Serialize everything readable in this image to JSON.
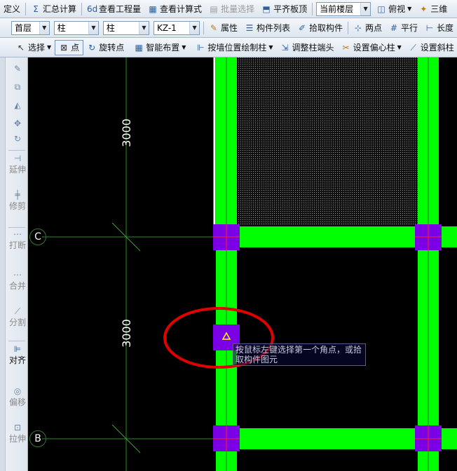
{
  "toolbar1": {
    "define": "定义",
    "sum_calc": "汇总计算",
    "view_quantity": "查看工程量",
    "view_formula": "查看计算式",
    "batch_select": "批量选择",
    "align_slab_top": "平齐板顶",
    "current_floor": "当前楼层",
    "top_view": "俯视",
    "three_d": "三维"
  },
  "toolbar2": {
    "floor_value": "首层",
    "type_value": "柱",
    "subtype_value": "柱",
    "component_value": "KZ-1",
    "properties": "属性",
    "component_list": "构件列表",
    "pick_component": "拾取构件",
    "two_points": "两点",
    "parallel": "平行",
    "long": "长度"
  },
  "toolbar3": {
    "select": "选择",
    "point": "点",
    "rotate_point": "旋转点",
    "smart_layout": "智能布置",
    "draw_by_wall": "按墙位置绘制柱",
    "adjust_column_end": "调整柱端头",
    "set_eccentric": "设置偏心柱",
    "set_slant": "设置斜柱"
  },
  "sidebar": {
    "items": [
      {
        "label": "延伸",
        "icon": "extend-icon"
      },
      {
        "label": "修剪",
        "icon": "trim-icon"
      },
      {
        "label": "打断",
        "icon": "break-icon"
      },
      {
        "label": "合并",
        "icon": "merge-icon"
      },
      {
        "label": "分割",
        "icon": "split-icon"
      },
      {
        "label": "对齐",
        "icon": "align-icon"
      },
      {
        "label": "偏移",
        "icon": "offset-icon"
      },
      {
        "label": "拉伸",
        "icon": "stretch-icon"
      }
    ]
  },
  "canvas": {
    "dim_top": "3000",
    "dim_mid": "3000",
    "axis_c": "C",
    "axis_b": "B",
    "tooltip": "按鼠标左键选择第一个角点，或拾取构件图元",
    "colors": {
      "beam": "#00ff00",
      "column": "#7b00e6",
      "axis_line": "#1f8f1f",
      "highlight_circle": "#e00000"
    }
  }
}
